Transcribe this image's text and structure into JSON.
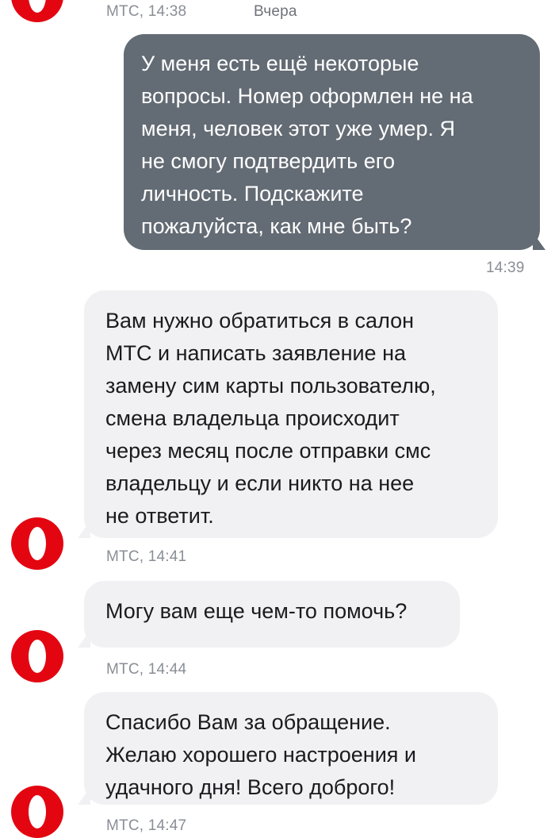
{
  "colors": {
    "outgoing_bubble": "#636b74",
    "incoming_bubble": "#f1f1f4",
    "brand_red": "#e30611",
    "meta_text": "#8a8e96"
  },
  "header": {
    "sender_time": "МТС, 14:38",
    "day_label": "Вчера"
  },
  "messages": [
    {
      "direction": "outgoing",
      "text": "У меня есть ещё некоторые\nвопросы. Номер оформлен не на\nменя, человек этот уже умер. Я\nне смогу подтвердить его\nличность. Подскажите\nпожалуйста, как мне быть?",
      "time": "14:39"
    },
    {
      "direction": "incoming",
      "text": "Вам нужно обратиться в салон\nМТС и написать заявление на\nзамену сим карты пользователю,\nсмена владельца происходит\nчерез месяц после отправки смс\nвладельцу и если никто на нее\nне ответит.",
      "meta": "МТС, 14:41",
      "avatar_icon": "mts-logo-icon"
    },
    {
      "direction": "incoming",
      "text": "Могу вам еще чем-то помочь?",
      "meta": "МТС, 14:44",
      "avatar_icon": "mts-logo-icon"
    },
    {
      "direction": "incoming",
      "text": "Спасибо Вам за обращение.\nЖелаю хорошего настроения и\nудачного дня! Всего доброго!",
      "meta": "МТС, 14:47",
      "avatar_icon": "mts-logo-icon"
    }
  ]
}
